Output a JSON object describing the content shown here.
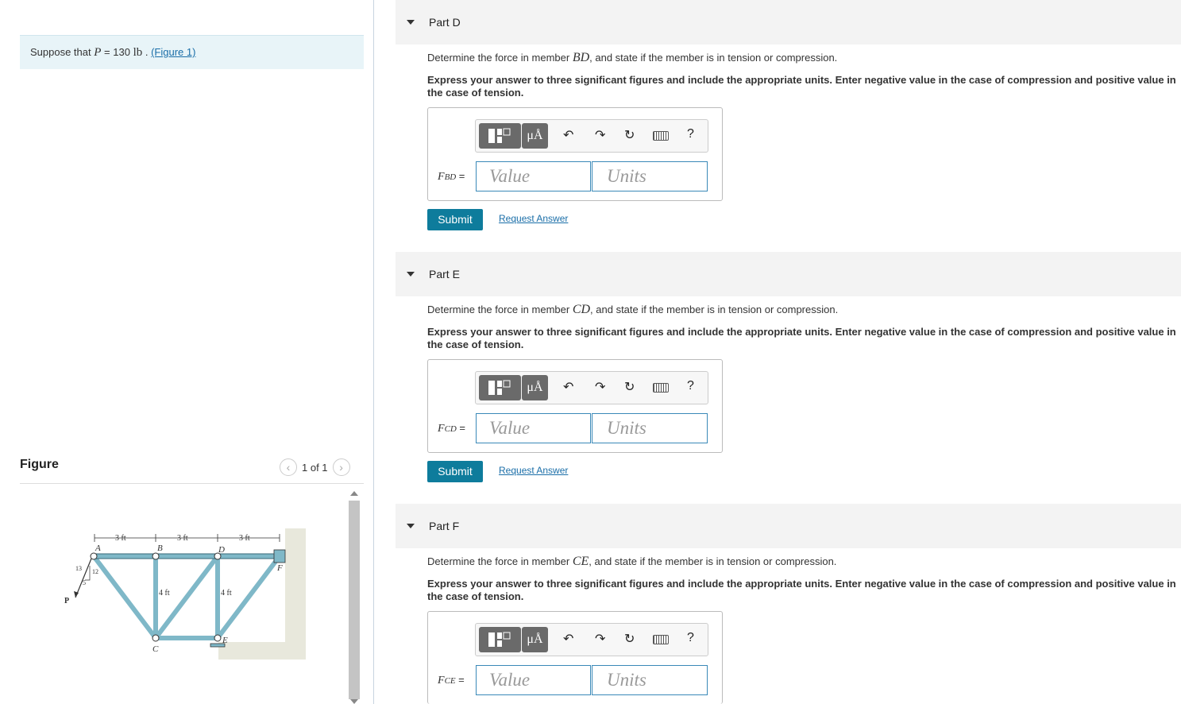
{
  "problem": {
    "prefix": "Suppose that",
    "var": "P",
    "equals": "= 130",
    "unit": "lb",
    "figure_link": "(Figure 1)"
  },
  "figure": {
    "title": "Figure",
    "pager": "1 of 1",
    "prev_icon": "chevron-left-icon",
    "next_icon": "chevron-right-icon",
    "labels": {
      "dim1": "3 ft",
      "dim2": "3 ft",
      "dim3": "3 ft",
      "A": "A",
      "B": "B",
      "D": "D",
      "F": "F",
      "C": "C",
      "E": "E",
      "h1": "4 ft",
      "h2": "4 ft",
      "s13": "13",
      "s12": "12",
      "s5": "5",
      "P": "P"
    }
  },
  "parts": [
    {
      "title": "Part D",
      "question_pre": "Determine the force in member",
      "member": "BD",
      "question_post": ", and state if the member is in tension or compression.",
      "instruction": "Express your answer to three significant figures and include the appropriate units. Enter negative value in the case of compression and positive value in the case of tension.",
      "label_var": "F",
      "label_sub": "BD",
      "label_eq": "=",
      "value_placeholder": "Value",
      "units_placeholder": "Units",
      "submit": "Submit",
      "request": "Request Answer"
    },
    {
      "title": "Part E",
      "question_pre": "Determine the force in member",
      "member": "CD",
      "question_post": ", and state if the member is in tension or compression.",
      "instruction": "Express your answer to three significant figures and include the appropriate units. Enter negative value in the case of compression and positive value in the case of tension.",
      "label_var": "F",
      "label_sub": "CD",
      "label_eq": "=",
      "value_placeholder": "Value",
      "units_placeholder": "Units",
      "submit": "Submit",
      "request": "Request Answer"
    },
    {
      "title": "Part F",
      "question_pre": "Determine the force in member",
      "member": "CE",
      "question_post": ", and state if the member is in tension or compression.",
      "instruction": "Express your answer to three significant figures and include the appropriate units. Enter negative value in the case of compression and positive value in the case of tension.",
      "label_var": "F",
      "label_sub": "CE",
      "label_eq": "=",
      "value_placeholder": "Value",
      "units_placeholder": "Units"
    }
  ],
  "toolbar": {
    "units_symbol": "μÅ",
    "help": "?",
    "icons": [
      "templates-icon",
      "units-icon",
      "undo-icon",
      "redo-icon",
      "reset-icon",
      "keyboard-icon",
      "help-icon"
    ]
  }
}
